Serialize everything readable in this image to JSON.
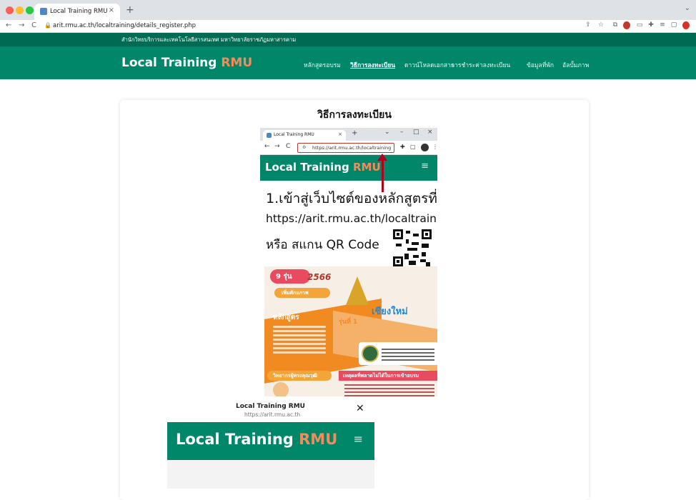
{
  "browser": {
    "tab_title": "Local Training RMU",
    "tab_close": "×",
    "new_tab": "+",
    "tab_menu": "⌄",
    "url": "arit.rmu.ac.th/localtraining/details_register.php",
    "traffic_colors": [
      "#ff5f57",
      "#febc2e",
      "#28c840"
    ],
    "nav": {
      "back": "←",
      "forward": "→",
      "reload": "C"
    },
    "toolbar_icons": [
      "share-icon",
      "star-icon",
      "extension-icon",
      "profile-icon"
    ]
  },
  "site": {
    "org_name": "สำนักวิทยบริการและเทคโนโลยีสารสนเทศ มหาวิทยาลัยราชภัฏมหาสารคาม",
    "brand_main": "Local Training",
    "brand_accent": "RMU",
    "menu": [
      {
        "label": "หลักสูตรอบรม",
        "active": false
      },
      {
        "label": "วิธีการลงทะเบียน",
        "active": true
      },
      {
        "label": "ดาวน์โหลดเอกสาร",
        "active": false
      },
      {
        "label": "การชำระค่าลงทะเบียน",
        "active": false
      },
      {
        "label": "ข้อมูลที่พัก",
        "active": false
      },
      {
        "label": "อัลบั้มภาพ",
        "active": false
      }
    ],
    "colors": {
      "top_bar": "#006b52",
      "nav_bar": "#00876a",
      "accent": "#f58a5a"
    }
  },
  "content": {
    "page_title": "วิธีการลงทะเบียน",
    "guide": {
      "tab_title": "Local Training RMU",
      "tab_close": "×",
      "new_tab": "+",
      "url": "https://arit.rmu.ac.th/localtraining",
      "brand_main": "Local Training",
      "brand_accent": "RMU",
      "step_text": "1.เข้าสู่เว็บไซต์ของหลักสูตรที่",
      "step_url": "https://arit.rmu.ac.th/localtraining",
      "step_or": "หรือ สแกน QR Code",
      "poster": {
        "badge": "9 รุ่น",
        "year": "2566",
        "pill": "เพิ่มศักยภาพ",
        "curriculum": "หลักสูตร",
        "city": "เชียงใหม่",
        "round": "รุ่นที่ 1",
        "trainer": "วิทยากรผู้ทรงคุณวุฒิ",
        "reason": "เหตุผลที่พลาดไม่ได้ในการเข้าอบรม"
      }
    },
    "popup": {
      "title": "Local Training RMU",
      "url": "https://arit.rmu.ac.th",
      "close": "✕",
      "brand_main": "Local Training",
      "brand_accent": "RMU"
    }
  }
}
